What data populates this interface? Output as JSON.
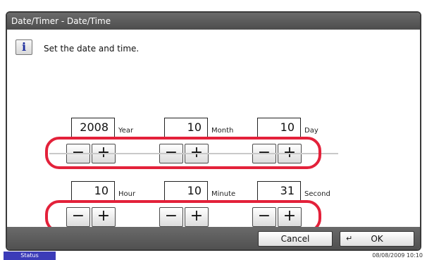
{
  "window": {
    "title": "Date/Timer - Date/Time"
  },
  "info": {
    "icon": "info-icon",
    "message": "Set the date and time."
  },
  "date_fields": [
    {
      "value": "2008",
      "unit": "Year"
    },
    {
      "value": "10",
      "unit": "Month"
    },
    {
      "value": "10",
      "unit": "Day"
    }
  ],
  "time_fields": [
    {
      "value": "10",
      "unit": "Hour"
    },
    {
      "value": "10",
      "unit": "Minute"
    },
    {
      "value": "31",
      "unit": "Second"
    }
  ],
  "stepper": {
    "minus": "−",
    "plus": "+"
  },
  "buttons": {
    "cancel": "Cancel",
    "ok": "OK",
    "enter_glyph": "↵"
  },
  "status": {
    "tab": "Status",
    "datetime": "08/08/2009  10:10"
  },
  "colors": {
    "highlight": "#e3213a",
    "status_tab": "#3b3bb8",
    "titlebar": "#5a5a5a"
  }
}
